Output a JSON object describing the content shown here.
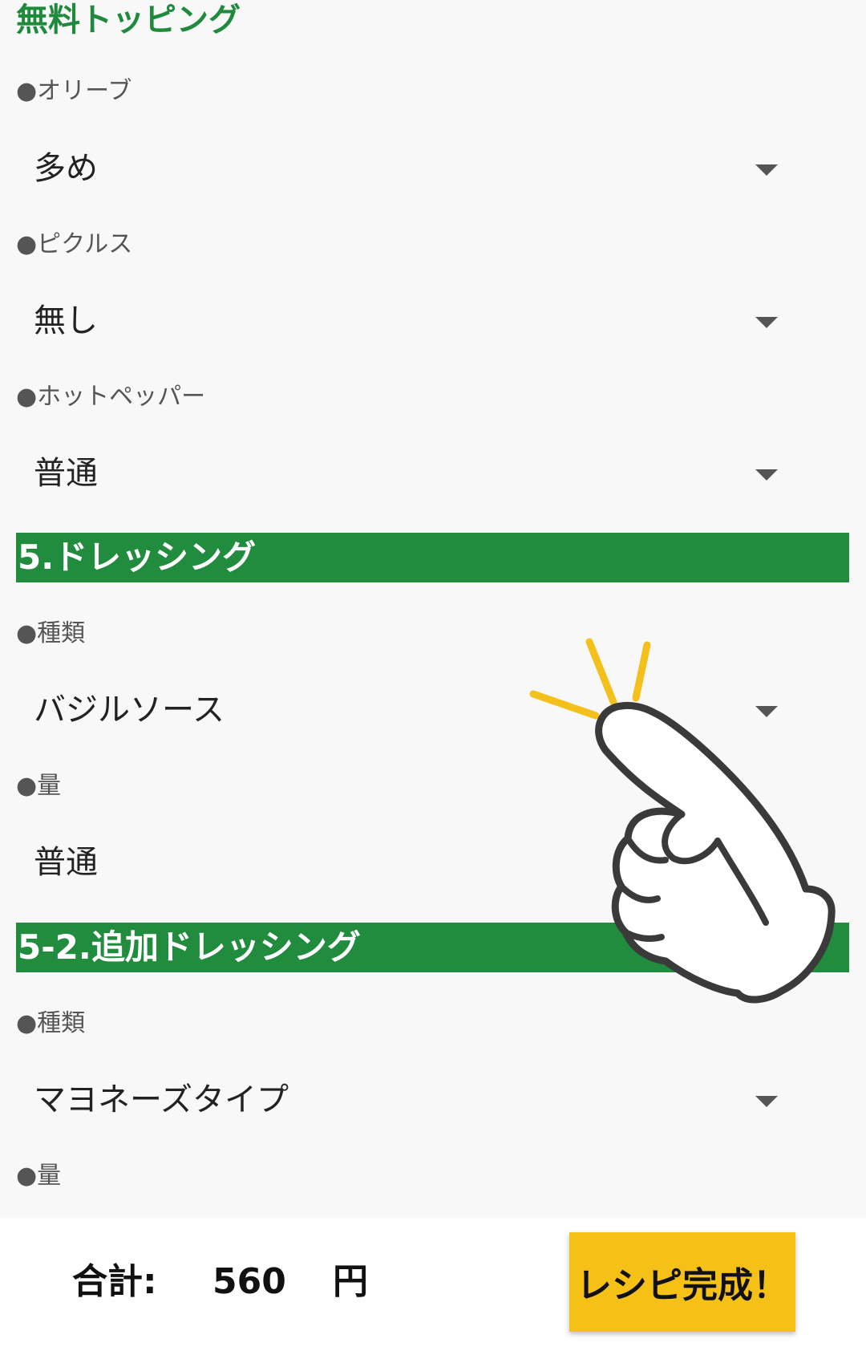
{
  "free_topping": {
    "title": "無料トッピング",
    "fields": [
      {
        "label": "●オリーブ",
        "value": "多め"
      },
      {
        "label": "●ピクルス",
        "value": "無し"
      },
      {
        "label": "●ホットペッパー",
        "value": "普通"
      }
    ]
  },
  "dressing": {
    "title": "5.ドレッシング",
    "fields": [
      {
        "label": "●種類",
        "value": "バジルソース"
      },
      {
        "label": "●量",
        "value": "普通"
      }
    ]
  },
  "extra_dressing": {
    "title": "5-2.追加ドレッシング",
    "fields": [
      {
        "label": "●種類",
        "value": "マヨネーズタイプ"
      },
      {
        "label": "●量"
      }
    ]
  },
  "footer": {
    "total_label": "合計:",
    "total_value": "560",
    "total_unit": "円",
    "complete_button": "レシピ完成！"
  },
  "icons": {
    "pointing_hand": "pointing-hand-icon",
    "dropdown": "triangle-down-icon"
  },
  "colors": {
    "green_heading": "#1f8a3b",
    "green_band": "#218b3e",
    "button_yellow": "#f6c117",
    "sparkle_yellow": "#f4c01c"
  }
}
